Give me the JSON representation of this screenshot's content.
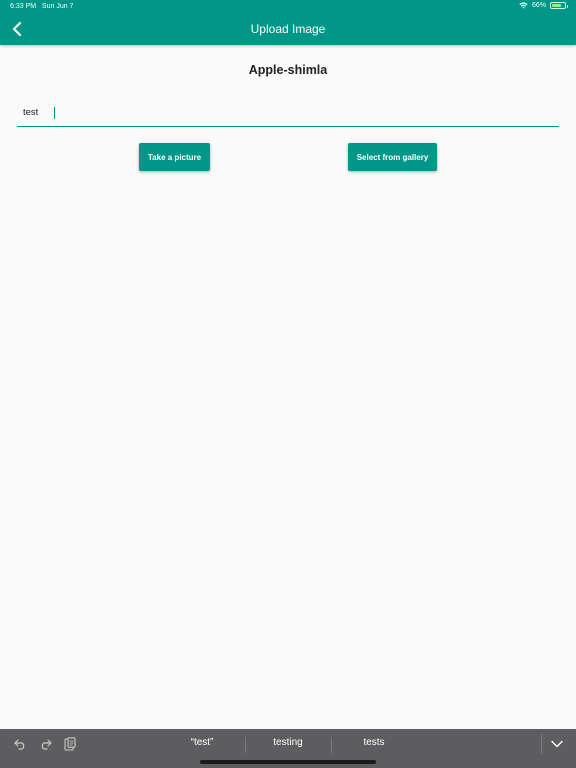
{
  "status_bar": {
    "time": "6:33 PM",
    "date": "Sun Jun 7",
    "battery": "66%",
    "battery_level": 0.66
  },
  "header": {
    "title": "Upload Image",
    "back_icon": "chevron-left-icon"
  },
  "main": {
    "plant_name": "Apple-shimla",
    "input": {
      "value": "test",
      "placeholder": ""
    },
    "buttons": {
      "take_picture": "Take a picture",
      "select_gallery": "Select from gallery"
    }
  },
  "keyboard_bar": {
    "tools": [
      "undo-icon",
      "redo-icon",
      "paste-icon"
    ],
    "suggestions": [
      "“test”",
      "testing",
      "tests"
    ],
    "dismiss_icon": "chevron-down-icon"
  },
  "colors": {
    "primary": "#009688",
    "background": "#fafafa",
    "keyboard_bar": "#5d5d5f"
  }
}
